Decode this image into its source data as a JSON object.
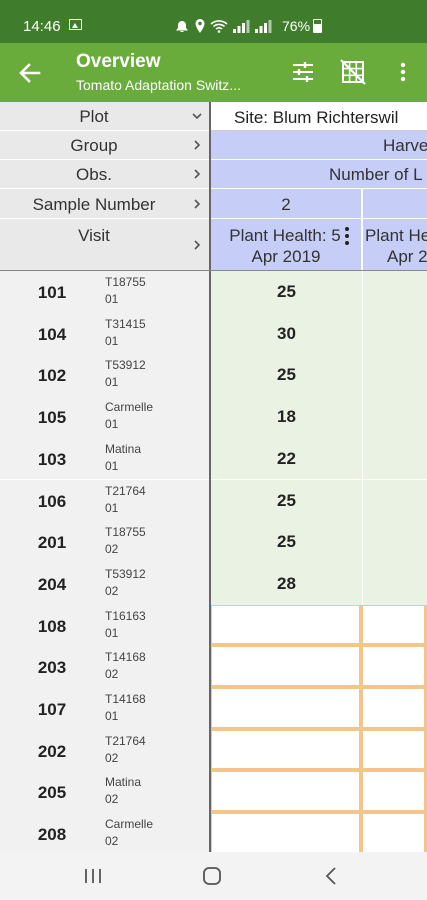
{
  "status_bar": {
    "time": "14:46",
    "battery": "76%",
    "icons": [
      "image-icon",
      "notification-icon",
      "location-icon",
      "wifi-icon",
      "signal-icon",
      "signal-icon",
      "battery-icon"
    ]
  },
  "app_bar": {
    "title": "Overview",
    "subtitle": "Tomato Adaptation Switz...",
    "actions": [
      "filter-icon",
      "grid-off-icon",
      "more-vert-icon"
    ],
    "color": "#69ac3b"
  },
  "header_left": [
    {
      "label": "Plot",
      "chevron": "down"
    },
    {
      "label": "Group",
      "chevron": "right"
    },
    {
      "label": "Obs.",
      "chevron": "right"
    },
    {
      "label": "Sample Number",
      "chevron": "right"
    },
    {
      "label": "Visit",
      "chevron": "right"
    }
  ],
  "header_right": {
    "site": "Site: Blum Richterswil",
    "group": "Harve",
    "obs": "Number of L",
    "sample_number": "2",
    "columns": [
      {
        "line1": "Plant Health: 5",
        "line2": "Apr 2019"
      },
      {
        "line1": "Plant He",
        "line2": "Apr 2"
      }
    ]
  },
  "rows": [
    {
      "plot": "101",
      "line1": "T18755",
      "line2": "01",
      "value": "25"
    },
    {
      "plot": "104",
      "line1": "T31415",
      "line2": "01",
      "value": "30"
    },
    {
      "plot": "102",
      "line1": "T53912",
      "line2": "01",
      "value": "25"
    },
    {
      "plot": "105",
      "line1": "Carmelle",
      "line2": "01",
      "value": "18"
    },
    {
      "plot": "103",
      "line1": "Matina",
      "line2": "01",
      "value": "22"
    },
    {
      "plot": "106",
      "line1": "T21764",
      "line2": "01",
      "value": "25"
    },
    {
      "plot": "201",
      "line1": "T18755",
      "line2": "02",
      "value": "25"
    },
    {
      "plot": "204",
      "line1": "T53912",
      "line2": "02",
      "value": "28"
    },
    {
      "plot": "108",
      "line1": "T16163",
      "line2": "01",
      "value": ""
    },
    {
      "plot": "203",
      "line1": "T14168",
      "line2": "02",
      "value": ""
    },
    {
      "plot": "107",
      "line1": "T14168",
      "line2": "01",
      "value": ""
    },
    {
      "plot": "202",
      "line1": "T21764",
      "line2": "02",
      "value": ""
    },
    {
      "plot": "205",
      "line1": "Matina",
      "line2": "02",
      "value": ""
    },
    {
      "plot": "208",
      "line1": "Carmelle",
      "line2": "02",
      "value": ""
    }
  ],
  "nav_bar": [
    "recents-icon",
    "home-icon",
    "back-icon"
  ]
}
